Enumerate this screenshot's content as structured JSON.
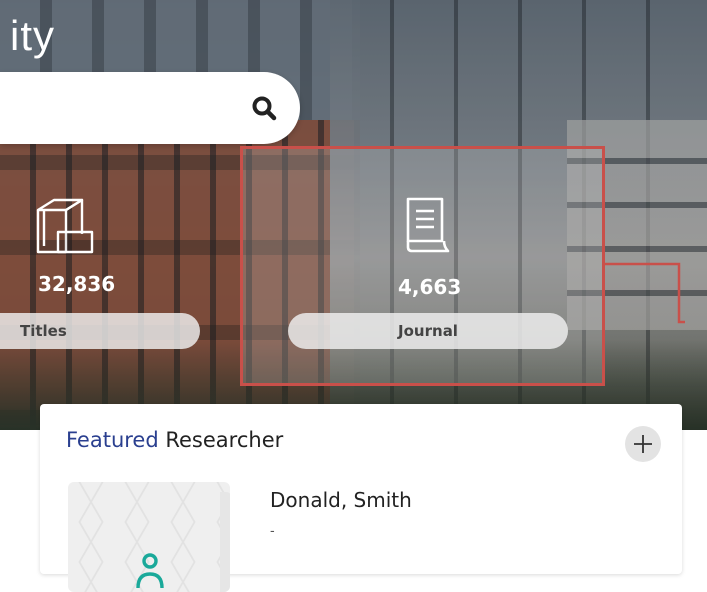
{
  "brand": {
    "text": "ity"
  },
  "search": {
    "placeholder": "",
    "button_icon": "search-icon"
  },
  "stats": [
    {
      "count": "32,836",
      "label": "Titles",
      "icon": "books-icon"
    },
    {
      "count": "4,663",
      "label": "Journal",
      "icon": "journal-icon"
    }
  ],
  "featured": {
    "title_accent": "Featured",
    "title_rest": " Researcher",
    "add_icon": "plus-icon",
    "researcher": {
      "name": "Donald, Smith",
      "dept": "-"
    }
  },
  "colors": {
    "highlight_border": "#c9504a",
    "accent": "#2a3f8f",
    "avatar_teal": "#1aa99a"
  }
}
